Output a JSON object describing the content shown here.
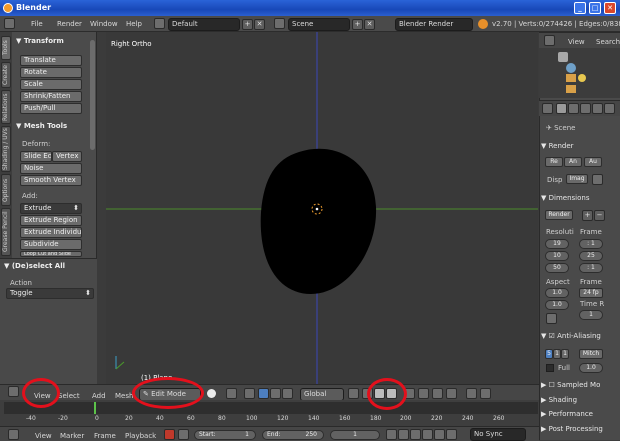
{
  "window": {
    "title": "Blender"
  },
  "info_header": {
    "menus": [
      "File",
      "Render",
      "Window",
      "Help"
    ],
    "layout": "Default",
    "scene": "Scene",
    "engine": "Blender Render",
    "stats": "v2.70 | Verts:0/274426 | Edges:0/838272"
  },
  "tools": {
    "tabs": [
      "Tools",
      "Create",
      "Relations",
      "Shading / UVs",
      "Options",
      "Grease Pencil"
    ],
    "transform_header": "Transform",
    "transform": [
      "Translate",
      "Rotate",
      "Scale",
      "Shrink/Fatten",
      "Push/Pull"
    ],
    "mesh_tools_header": "Mesh Tools",
    "deform_label": "Deform:",
    "slide_edge": "Slide Ed",
    "vertex": "Vertex",
    "noise": "Noise",
    "smooth_vertex": "Smooth Vertex",
    "add_label": "Add:",
    "extrude": "Extrude",
    "extrude_region": "Extrude Region",
    "extrude_individual": "Extrude Individual",
    "subdivide": "Subdivide",
    "cut_off": "Loop Cut and Slide"
  },
  "operator": {
    "header": "(De)select All",
    "action_label": "Action",
    "action_value": "Toggle"
  },
  "viewport": {
    "label": "Right Ortho",
    "object_label": "(1) Plane"
  },
  "view3d_header": {
    "view": "View",
    "select": "Select",
    "add": "Add",
    "mesh": "Mesh",
    "mode": "Edit Mode",
    "orientation": "Global"
  },
  "timeline": {
    "ticks": [
      "-40",
      "-20",
      "0",
      "20",
      "40",
      "60",
      "80",
      "100",
      "120",
      "140",
      "160",
      "180",
      "200",
      "220",
      "240",
      "260"
    ],
    "menus": [
      "View",
      "Marker",
      "Frame",
      "Playback"
    ],
    "start": "Start:",
    "start_val": "1",
    "end": "End:",
    "end_val": "250",
    "current": "1",
    "sync": "No Sync"
  },
  "outliner": {
    "view": "View",
    "search": "Search"
  },
  "properties": {
    "scene": "Scene",
    "render_header": "Render",
    "render_buttons": [
      "Re",
      "An",
      "Au"
    ],
    "display_label": "Disp",
    "display_value": "Imag",
    "dimensions_header": "Dimensions",
    "render_preset": "Render",
    "resolution_label": "Resoluti",
    "frame_label": "Frame",
    "res_x": "19",
    "res_y": "10",
    "res_pct": "50",
    "frame_start": ": 1",
    "frame_end": "25",
    "frame_step": ": 1",
    "aspect_label": "Aspect",
    "aspect_frame_label": "Frame",
    "aspect_x": "1.0",
    "aspect_y": "1.0",
    "fps": "24 fp",
    "time_label": "Time R",
    "time_val": "1",
    "aa_header": "Anti-Aliasing",
    "aa_samples": [
      "5",
      "1",
      "1"
    ],
    "aa_filter": "Mitch",
    "full_label": "Full",
    "full_value": "1.0",
    "sampled_motion": "Sampled Mo",
    "shading": "Shading",
    "performance": "Performance",
    "post_processing": "Post Processing"
  },
  "colors": {
    "annotation": "#e3101c",
    "x_axis": "#4a8a2a",
    "y_axis": "#3a46b8",
    "object": "#000000"
  }
}
